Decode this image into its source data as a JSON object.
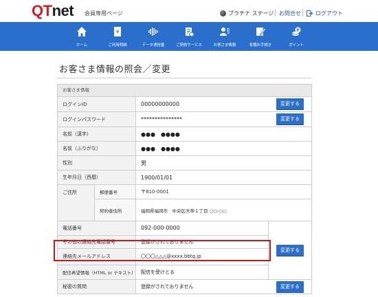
{
  "header": {
    "logo_q": "Q",
    "logo_t": "T",
    "logo_net": "net",
    "subtitle": "会員専用ページ",
    "rank": "プラチナ ステージ",
    "contact": "お問合せ",
    "logout": "ログアウト"
  },
  "nav": [
    {
      "label": "ホーム",
      "icon": "home-icon"
    },
    {
      "label": "ご利用明細",
      "icon": "receipt-icon"
    },
    {
      "label": "データ通信量",
      "icon": "waveform-icon"
    },
    {
      "label": "ご契約サービス",
      "icon": "clipboard-icon"
    },
    {
      "label": "お客さま情報",
      "icon": "user-icon"
    },
    {
      "label": "各種お手続き",
      "icon": "pencil-icon"
    },
    {
      "label": "ポイント",
      "icon": "coin-icon"
    }
  ],
  "page_title": "お客さま情報の照会／変更",
  "section_title": "お客さま情報",
  "change_button": "変更する",
  "rows": {
    "login_id": {
      "label": "ログインID",
      "value": "00000000000"
    },
    "password": {
      "label": "ログインパスワード",
      "value": "***************"
    },
    "name_kanji": {
      "label": "名前（漢字）",
      "value": "●●●　●●●●"
    },
    "name_kana": {
      "label": "名前（ふりがな）",
      "value": "●●●　●●●●"
    },
    "gender": {
      "label": "性別",
      "value": "男"
    },
    "birthday": {
      "label": "生年月日（西暦）",
      "value": "1900/01/01"
    },
    "address": {
      "label": "ご住所",
      "postal_label": "郵便番号",
      "postal_value": "〒810-0001",
      "contract_label": "契約者住所",
      "contract_value": "福岡県福岡市　中央区天神１丁目 ○○-○○"
    },
    "phone": {
      "label": "電話番号",
      "value": "092-000-0000"
    },
    "other_phone": {
      "label": "その他の連絡先電話番号",
      "value": "登録がされておりません"
    },
    "email": {
      "label": "連絡先メールアドレス",
      "value": "〇〇〇△△△@xxxx.bbtq.jp"
    },
    "delivery": {
      "label": "配信希望情報（HTML or テキスト）",
      "value": "配信を受けとる"
    },
    "secret": {
      "label": "秘密の質問",
      "value": "登録がされておりません"
    }
  },
  "colors": {
    "brand_red": "#d21c24",
    "nav_blue": "#2b6fcc",
    "highlight": "#d0141b"
  }
}
